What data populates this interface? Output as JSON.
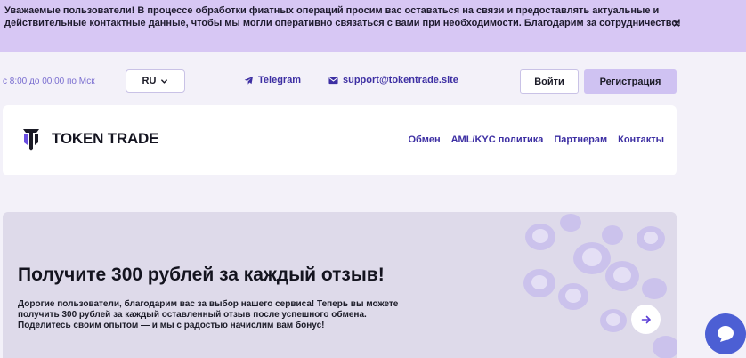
{
  "banner": {
    "text": "Уважаемые пользователи! В процессе обработки фиатных операций просим вас оставаться на связи и предоставлять актуальные и действительные контактные данные, чтобы мы могли оперативно связаться с вами при необходимости. Благодарим за сотрудничество!",
    "close_label": "×"
  },
  "topbar": {
    "hours": "с 8:00 до 00:00 по Мск",
    "language": "RU",
    "telegram_label": "Telegram",
    "email": "support@tokentrade.site",
    "login_label": "Войти",
    "register_label": "Регистрация"
  },
  "header": {
    "logo_text": "TOKEN TRADE",
    "nav": [
      "Обмен",
      "AML/KYC политика",
      "Партнерам",
      "Контакты"
    ]
  },
  "promo": {
    "title": "Получите 300 рублей за каждый отзыв!",
    "text": "Дорогие пользователи, благодарим вас за выбор нашего сервиса! Теперь вы можете получить 300 рублей за каждый оставленный отзыв после успешного обмена. Поделитесь своим опытом — и мы с радостью начислим вам бонус!"
  },
  "colors": {
    "banner_bg": "#d7c7f4",
    "accent": "#3d2fa3",
    "register_bg": "#cfc2f2",
    "chat_bg": "#4c5fd4"
  },
  "icons": {
    "close": "close-icon",
    "language_dropdown": "chevron-down-icon",
    "telegram": "telegram-icon",
    "email": "mail-icon",
    "logo": "token-trade-logo-icon",
    "promo_arrow": "arrow-right-icon",
    "chat": "chat-icon"
  }
}
